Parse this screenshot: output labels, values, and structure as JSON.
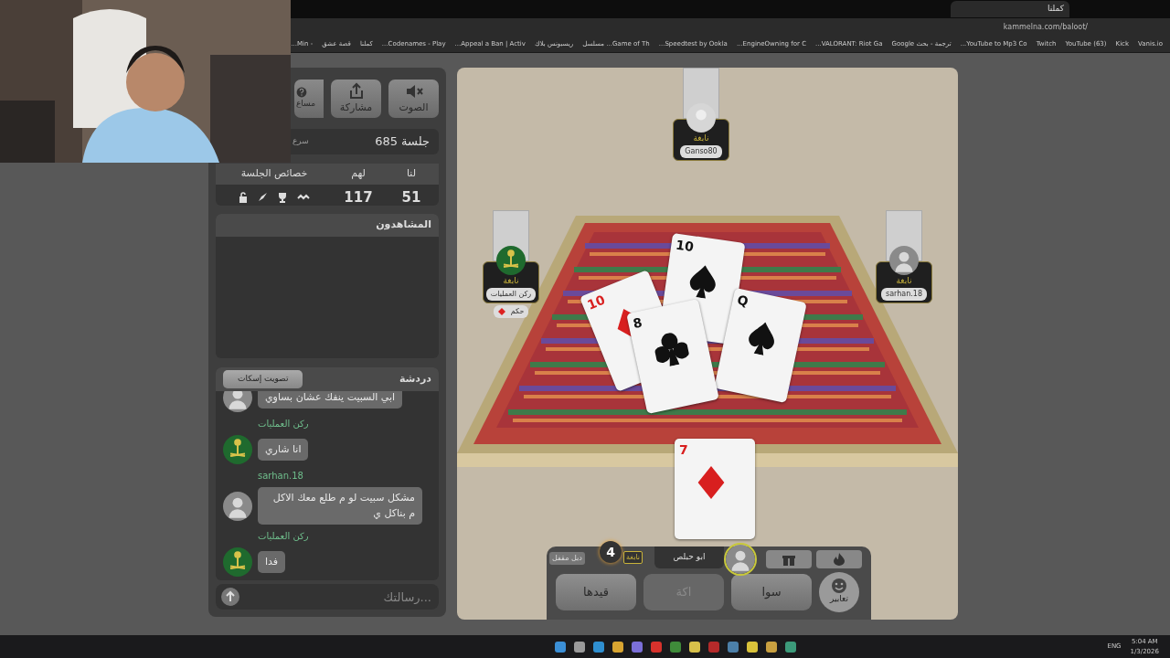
{
  "browser": {
    "tab_title": "كملنا",
    "url": "kammelna.com/baloot/",
    "bookmarks": [
      "Vanis.io",
      "Kick",
      "(63) YouTube",
      "Twitch",
      "YouTube to Mp3 Co...",
      "ترجمة - بحث Google",
      "VALORANT: Riot Ga...",
      "EngineOwning for C...",
      "Speedtest by Ookla...",
      "Game of Th... مسلسل",
      "ريسبونس بلاك",
      "Appeal a Ban | Activ...",
      "Codenames - Play...",
      "كملنا",
      "قصة عشق",
      "- Min..."
    ]
  },
  "toolbar": [
    {
      "label": "الصوت"
    },
    {
      "label": "مشاركة"
    },
    {
      "label": "مساع"
    }
  ],
  "session": {
    "title": "جلسة 685",
    "note": "سرع"
  },
  "score": {
    "headers": [
      "لنا",
      "لهم",
      "خصائص الجلسة"
    ],
    "us": "51",
    "them": "117"
  },
  "spectators": {
    "title": "المشاهدون"
  },
  "chat": {
    "title": "دردشة",
    "mute_vote": "تصويت إسكات",
    "placeholder": "رسالتك...",
    "messages": [
      {
        "text": "ابي السبيت ينفك عشان بساوي"
      },
      {
        "author": "ركن العمليات",
        "text": "انا شاري",
        "kind": "emblem"
      },
      {
        "author": "sarhan.18",
        "text": "مشكل سبيت لو م طلع معك الاكل م بناكل ي"
      },
      {
        "author": "ركن العمليات",
        "text": "فدا",
        "kind": "emblem"
      }
    ]
  },
  "players": [
    {
      "name": "Ganso80",
      "rank": "نابغة",
      "kind": "blank"
    },
    {
      "name": "sarhan.18",
      "rank": "نابغة"
    },
    {
      "name": "ركن العمليات",
      "rank": "نابغة",
      "kind": "emblem",
      "trump": "حكم"
    }
  ],
  "table_cards": [
    {
      "rank": "10",
      "kind": "spade"
    },
    {
      "rank": "10",
      "kind": "diamond"
    },
    {
      "rank": "Q",
      "kind": "spade"
    },
    {
      "rank": "8",
      "kind": "club"
    }
  ],
  "hand_card": {
    "rank": "7",
    "kind": "diamond"
  },
  "me": {
    "name": "ابو حبلص",
    "rank": "نابغة",
    "count": "4",
    "tag": "دبل مقفل"
  },
  "actions": [
    {
      "label": "سوا",
      "disabled": false
    },
    {
      "label": "اكة",
      "disabled": true
    },
    {
      "label": "قيدها",
      "disabled": false
    }
  ],
  "emotes": {
    "label": "تعابير"
  },
  "taskbar": {
    "lang": "ENG",
    "time": "5:04 AM",
    "date": "1/3/2026",
    "apps": [
      {
        "color": "#3b8fd6"
      },
      {
        "color": "#9a9a9a"
      },
      {
        "color": "#2f8fd0"
      },
      {
        "color": "#d9a531"
      },
      {
        "color": "#7b6fd8"
      },
      {
        "color": "#d8322c"
      },
      {
        "color": "#3f8b3a"
      },
      {
        "color": "#d7c04a"
      },
      {
        "color": "#b52a2a"
      },
      {
        "color": "#4c7fa8"
      },
      {
        "color": "#d9c23a"
      },
      {
        "color": "#c9a040"
      },
      {
        "color": "#3c9a7a"
      }
    ]
  }
}
